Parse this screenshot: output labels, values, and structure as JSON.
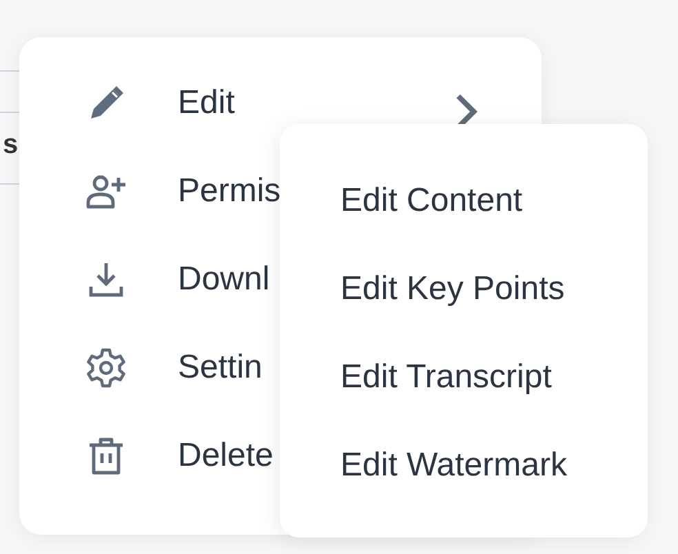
{
  "background": {
    "heading_fragment": "s"
  },
  "menu": {
    "items": [
      {
        "label": "Edit",
        "has_submenu": true
      },
      {
        "label": "Permis",
        "has_submenu": false
      },
      {
        "label": "Downl",
        "has_submenu": false
      },
      {
        "label": "Settin",
        "has_submenu": false
      },
      {
        "label": "Delete",
        "has_submenu": false
      }
    ]
  },
  "submenu": {
    "items": [
      {
        "label": "Edit Content"
      },
      {
        "label": "Edit Key Points"
      },
      {
        "label": "Edit Transcript"
      },
      {
        "label": "Edit Watermark"
      }
    ]
  }
}
